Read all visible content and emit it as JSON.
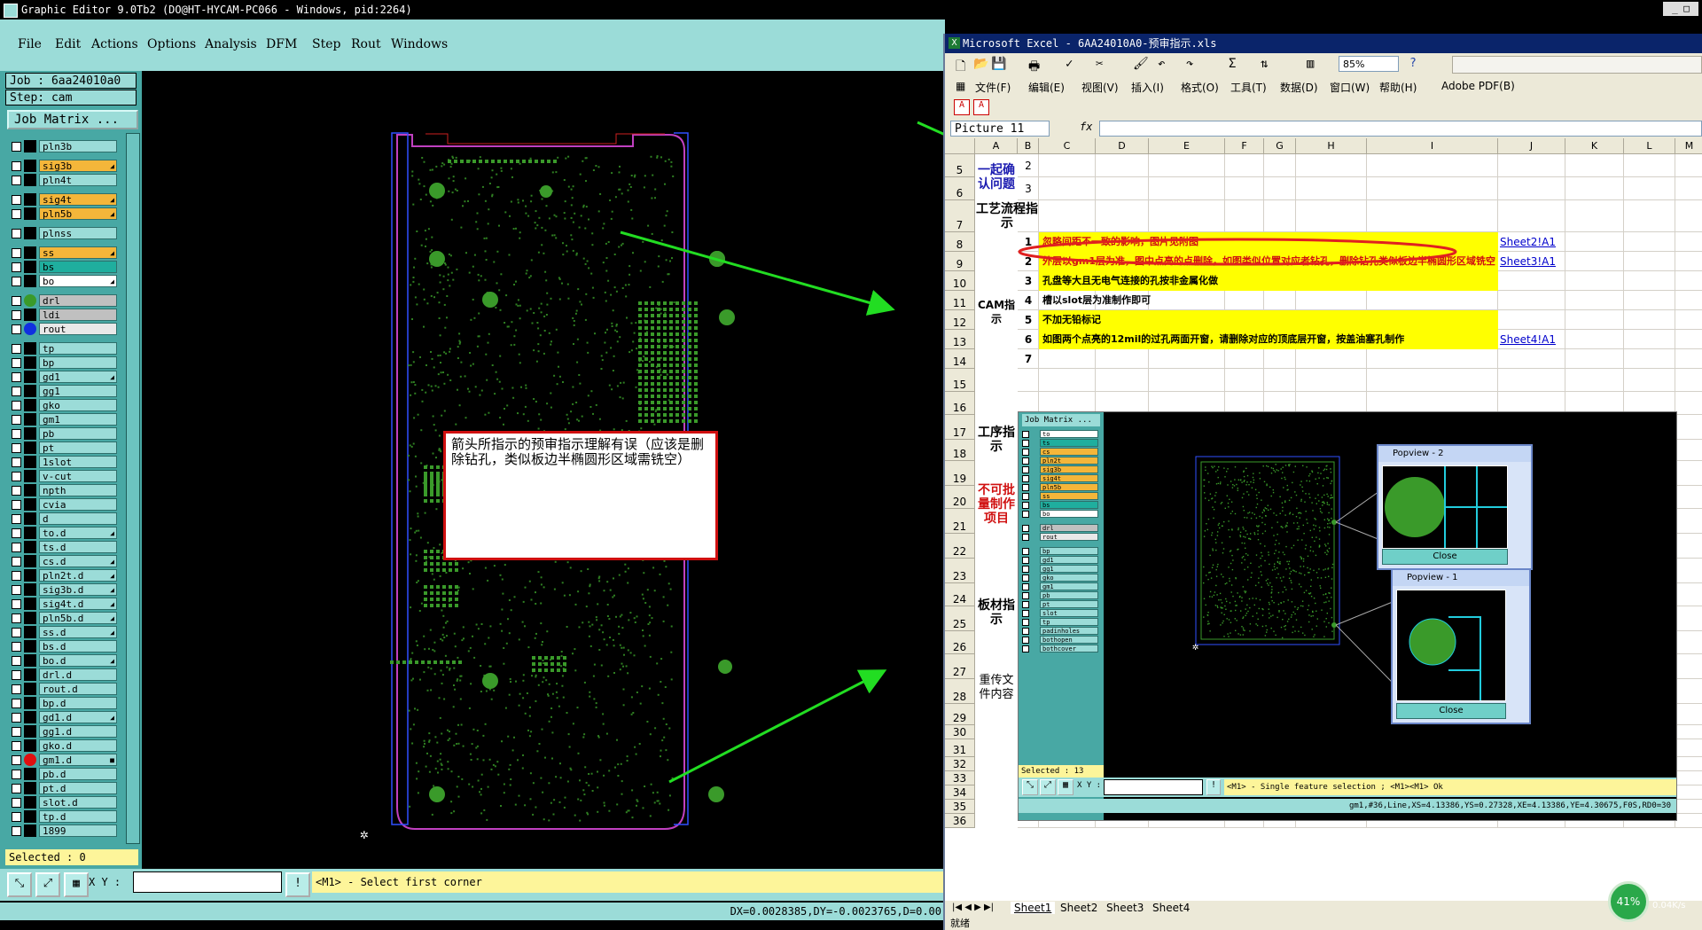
{
  "graphic_editor": {
    "title": "Graphic Editor 9.0Tb2 (DO@HT-HYCAM-PC066 - Windows, pid:2264)",
    "menu": [
      "File",
      "Edit",
      "Actions",
      "Options",
      "Analysis",
      "DFM",
      "Step",
      "Rout",
      "Windows"
    ],
    "job": "Job : 6aa24010a0",
    "step": "Step: cam",
    "job_matrix_button": "Job Matrix ...",
    "layers": [
      {
        "name": "pln3b",
        "color": "#000000",
        "dir": ""
      },
      {
        "name": "sig3b",
        "color": "#000000",
        "dir": "◢",
        "hl": "#f4b63a"
      },
      {
        "name": "pln4t",
        "color": "#000000",
        "dir": ""
      },
      {
        "name": "sig4t",
        "color": "#000000",
        "dir": "◢",
        "hl": "#f4b63a"
      },
      {
        "name": "pln5b",
        "color": "#000000",
        "dir": "◢",
        "hl": "#f4b63a"
      },
      {
        "name": "plnss",
        "color": "#000000",
        "dir": ""
      },
      {
        "name": "ss",
        "color": "#000000",
        "dir": "◢",
        "hl": "#f4b63a"
      },
      {
        "name": "bs",
        "color": "#000000",
        "dir": "",
        "hl": "#1fae9e"
      },
      {
        "name": "bo",
        "color": "#000000",
        "dir": "◢",
        "hl": "#ffffff"
      },
      {
        "name": "drl",
        "color": "#3a9a2a",
        "dir": "",
        "hl": "#c0c0c0"
      },
      {
        "name": "ldi",
        "color": "#000000",
        "dir": "",
        "hl": "#c0c0c0"
      },
      {
        "name": "rout",
        "color": "#1030e0",
        "dir": "",
        "hl": "#e8e8e8"
      },
      {
        "name": "tp",
        "color": "#000000",
        "dir": ""
      },
      {
        "name": "bp",
        "color": "#000000",
        "dir": ""
      },
      {
        "name": "gd1",
        "color": "#000000",
        "dir": "◢"
      },
      {
        "name": "gg1",
        "color": "#000000",
        "dir": ""
      },
      {
        "name": "gko",
        "color": "#000000",
        "dir": ""
      },
      {
        "name": "gm1",
        "color": "#000000",
        "dir": ""
      },
      {
        "name": "pb",
        "color": "#000000",
        "dir": ""
      },
      {
        "name": "pt",
        "color": "#000000",
        "dir": ""
      },
      {
        "name": "1slot",
        "color": "#000000",
        "dir": ""
      },
      {
        "name": "v-cut",
        "color": "#000000",
        "dir": ""
      },
      {
        "name": "npth",
        "color": "#000000",
        "dir": ""
      },
      {
        "name": "cvia",
        "color": "#000000",
        "dir": ""
      },
      {
        "name": "d",
        "color": "#000000",
        "dir": ""
      },
      {
        "name": "to.d",
        "color": "#000000",
        "dir": "◢"
      },
      {
        "name": "ts.d",
        "color": "#000000",
        "dir": ""
      },
      {
        "name": "cs.d",
        "color": "#000000",
        "dir": "◢"
      },
      {
        "name": "pln2t.d",
        "color": "#000000",
        "dir": "◢"
      },
      {
        "name": "sig3b.d",
        "color": "#000000",
        "dir": "◢"
      },
      {
        "name": "sig4t.d",
        "color": "#000000",
        "dir": "◢"
      },
      {
        "name": "pln5b.d",
        "color": "#000000",
        "dir": "◢"
      },
      {
        "name": "ss.d",
        "color": "#000000",
        "dir": "◢"
      },
      {
        "name": "bs.d",
        "color": "#000000",
        "dir": ""
      },
      {
        "name": "bo.d",
        "color": "#000000",
        "dir": "◢"
      },
      {
        "name": "drl.d",
        "color": "#000000",
        "dir": ""
      },
      {
        "name": "rout.d",
        "color": "#000000",
        "dir": ""
      },
      {
        "name": "bp.d",
        "color": "#000000",
        "dir": ""
      },
      {
        "name": "gd1.d",
        "color": "#000000",
        "dir": "◢"
      },
      {
        "name": "gg1.d",
        "color": "#000000",
        "dir": ""
      },
      {
        "name": "gko.d",
        "color": "#000000",
        "dir": ""
      },
      {
        "name": "gm1.d",
        "color": "#e01010",
        "dir": "■"
      },
      {
        "name": "pb.d",
        "color": "#000000",
        "dir": ""
      },
      {
        "name": "pt.d",
        "color": "#000000",
        "dir": ""
      },
      {
        "name": "slot.d",
        "color": "#000000",
        "dir": ""
      },
      {
        "name": "tp.d",
        "color": "#000000",
        "dir": ""
      },
      {
        "name": "1899",
        "color": "#000000",
        "dir": ""
      }
    ],
    "selected": "Selected : 0",
    "xy_label": "X Y :",
    "prompt": "<M1> - Select first corner",
    "status": "DX=0.0028385,DY=-0.0023765,D=0.00",
    "note": "箭头所指示的预审指示理解有误（应该是删除钻孔，类似板边半椭圆形区域需铣空）"
  },
  "excel": {
    "title": "Microsoft Excel - 6AA24010A0-预审指示.xls",
    "zoom": "85%",
    "menu": [
      "文件(F)",
      "编辑(E)",
      "视图(V)",
      "插入(I)",
      "格式(O)",
      "工具(T)",
      "数据(D)",
      "窗口(W)",
      "帮助(H)",
      "Adobe PDF(B)"
    ],
    "namebox": "Picture 11",
    "fx": "fx",
    "columns": [
      "A",
      "B",
      "C",
      "D",
      "E",
      "F",
      "G",
      "H",
      "I",
      "J",
      "K",
      "L",
      "M"
    ],
    "rows": [
      "5",
      "6",
      "7",
      "8",
      "9",
      "10",
      "11",
      "12",
      "13",
      "14",
      "15",
      "16",
      "17",
      "18",
      "19",
      "20",
      "21",
      "22",
      "23",
      "24",
      "25",
      "26",
      "27",
      "28",
      "29",
      "30",
      "31",
      "32",
      "33",
      "34",
      "35",
      "36"
    ],
    "section_confirm": "一起确认问题",
    "b5": "2",
    "b6": "3",
    "section_flow": "工艺流程指示",
    "section_cam": "CAM指示",
    "section_process": "工序指示",
    "section_nonbatch": "不可批量制作项目",
    "section_board": "板材指示",
    "section_reissue": "重传文件内容",
    "cam_items": [
      {
        "n": "1",
        "text": "忽略间距不一致的影响，图片见附图",
        "link": "Sheet2!A1",
        "red": true
      },
      {
        "n": "2",
        "text": "外层以gm1层为准，图中点亮的点删除，如图类似位置对应者钻孔，删除钻孔类似板边半椭圆形区域铣空",
        "link": "Sheet3!A1",
        "red": true
      },
      {
        "n": "3",
        "text": "孔盘等大且无电气连接的孔按非金属化做",
        "link": "",
        "red": false
      },
      {
        "n": "4",
        "text": "槽以slot层为准制作即可",
        "link": "",
        "red": false,
        "white": true
      },
      {
        "n": "5",
        "text": "不加无铅标记",
        "link": "",
        "red": false
      },
      {
        "n": "6",
        "text": "如图两个点亮的12mil的过孔两面开窗，请删除对应的顶底层开窗，按盖油塞孔制作",
        "link": "Sheet4!A1",
        "red": false
      },
      {
        "n": "7",
        "text": "",
        "link": "",
        "red": false,
        "white": true
      }
    ],
    "sheet_tabs": [
      "Sheet1",
      "Sheet2",
      "Sheet3",
      "Sheet4"
    ],
    "status": "就绪"
  },
  "picture": {
    "job_matrix": "Job Matrix ...",
    "layers": [
      "to",
      "ts",
      "cs",
      "pln2t",
      "sig3b",
      "sig4t",
      "pln5b",
      "ss",
      "bs",
      "bo",
      "drl",
      "rout",
      "bp",
      "gd1",
      "gg1",
      "gko",
      "gm1",
      "pb",
      "pt",
      "slot",
      "tp",
      "padinholes",
      "bothopen",
      "bothcover"
    ],
    "selected": "Selected : 13",
    "xy_label": "X Y :",
    "prompt": "<M1> - Single feature selection ; <M1><M1> Ok",
    "status": "gm1,#36,Line,XS=4.13386,YS=0.27328,XE=4.13386,YE=4.30675,F0S,RD0=30",
    "popview2": {
      "title": "Popview - 2",
      "close": "Close"
    },
    "popview1": {
      "title": "Popview - 1",
      "close": "Close"
    }
  },
  "network": {
    "percent": "41%",
    "up": "0K/s",
    "down": "0.04K/s"
  },
  "colors": {
    "cyan_ui": "#9bdcd8",
    "pcb_green": "#3a9a2a",
    "arrow": "#22dd22",
    "highlight_yellow": "#ffff00"
  }
}
